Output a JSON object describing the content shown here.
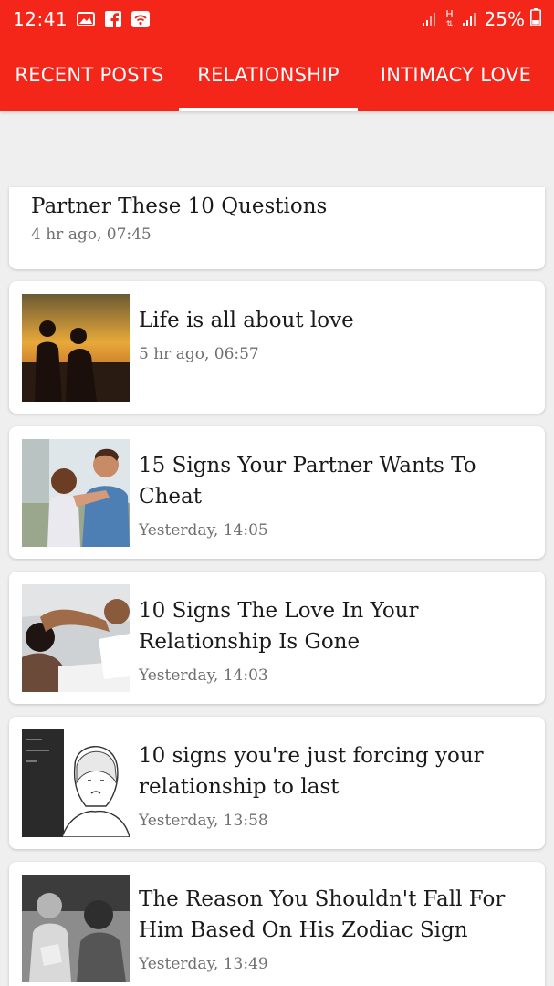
{
  "status_bar": {
    "time": "12:41",
    "network": "H",
    "battery": "25%"
  },
  "tabs": [
    {
      "label": "RECENT POSTS",
      "active": false
    },
    {
      "label": "RELATIONSHIP",
      "active": true
    },
    {
      "label": "INTIMACY LOVE",
      "active": false
    }
  ],
  "posts": [
    {
      "title": "Partner These 10 Questions",
      "time": "4 hr ago, 07:45",
      "thumbnail": "none"
    },
    {
      "title": "Life is all about love",
      "time": "5 hr ago, 06:57",
      "thumbnail": "couple-sunset-silhouette"
    },
    {
      "title": "15 Signs Your Partner Wants To Cheat",
      "time": "Yesterday, 14:05",
      "thumbnail": "couple-embrace-outdoors"
    },
    {
      "title": "10 Signs The Love In Your Relationship Is Gone",
      "time": "Yesterday, 14:03",
      "thumbnail": "couple-lying-bed"
    },
    {
      "title": "10 signs you're just forcing your relationship to last",
      "time": "Yesterday, 13:58",
      "thumbnail": "sketch-sad-woman"
    },
    {
      "title": "The Reason You Shouldn't Fall For Him Based On His Zodiac Sign",
      "time": "Yesterday, 13:49",
      "thumbnail": "couple-bw-photo"
    }
  ],
  "colors": {
    "primary": "#f4261a",
    "background": "#efefef",
    "card": "#ffffff"
  }
}
